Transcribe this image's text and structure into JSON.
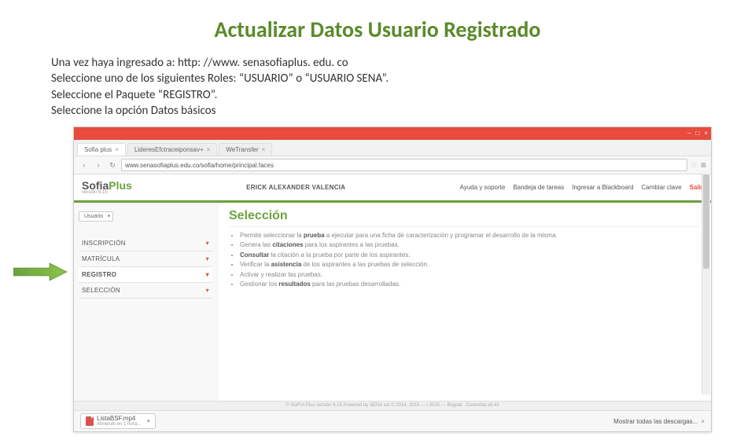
{
  "slide": {
    "title": "Actualizar Datos Usuario Registrado",
    "lines": [
      "Una vez haya ingresado a: http: //www. senasofiaplus. edu. co",
      "Seleccione uno de los siguientes Roles: “USUARIO” o “USUARIO SENA”.",
      "Seleccione el Paquete “REGISTRO”.",
      "Seleccione la opción Datos básicos"
    ]
  },
  "browser": {
    "win": {
      "min": "–",
      "max": "□",
      "close": "×"
    },
    "tabs": [
      {
        "label": "Sofia plus",
        "close": "×"
      },
      {
        "label": "LideresEfctraceiponsav+",
        "close": "×"
      },
      {
        "label": "WeTransfer",
        "close": "×"
      }
    ],
    "nav": {
      "back": "‹",
      "fwd": "›",
      "reload": "↻"
    },
    "url": "www.senasofiaplus.edu.co/sofia/home/principal.faces",
    "star": "☆",
    "menu": "≡"
  },
  "site": {
    "logo": {
      "main": "Sofia",
      "plus": "Plus",
      "sub": "versión 6.15"
    },
    "user": "ERICK ALEXANDER VALENCIA",
    "top_links": [
      "Ayuda y soporte",
      "Bandeja de tareas",
      "Ingresar a Blackboard",
      "Cambiar clave"
    ],
    "exit": "Salir",
    "role": "Usuario",
    "sidebar": [
      "INSCRIPCIÓN",
      "MATRÍCULA",
      "REGISTRO",
      "SELECCIÓN"
    ],
    "content_title": "Selección",
    "bullets_html": [
      "Permite seleccionar la <b>prueba</b> a ejecutar para una ficha de caracterización y programar el desarrollo de la misma.",
      "Genera las <b>citaciones</b> para los aspirantes a las pruebas.",
      "<b>Consultar</b> la citación a la prueba por parte de los aspirantes.",
      "Verificar la <b>asistencia</b> de los aspirantes a las pruebas de selección.",
      "Activar y realizar las pruebas.",
      "Gestionar los <b>resultados</b> para las pruebas desarrolladas."
    ],
    "footer": "© SOFIA Plus versión 6.15   Powered by SENA est © 2014, 2015 — l 2015 — Bogotá - Colombia   v6.43"
  },
  "download": {
    "file": "ListaBSF.mp4",
    "status": "Abriendo en 1 hora...",
    "showall": "Mostrar todas las descargas...",
    "x": "×"
  }
}
